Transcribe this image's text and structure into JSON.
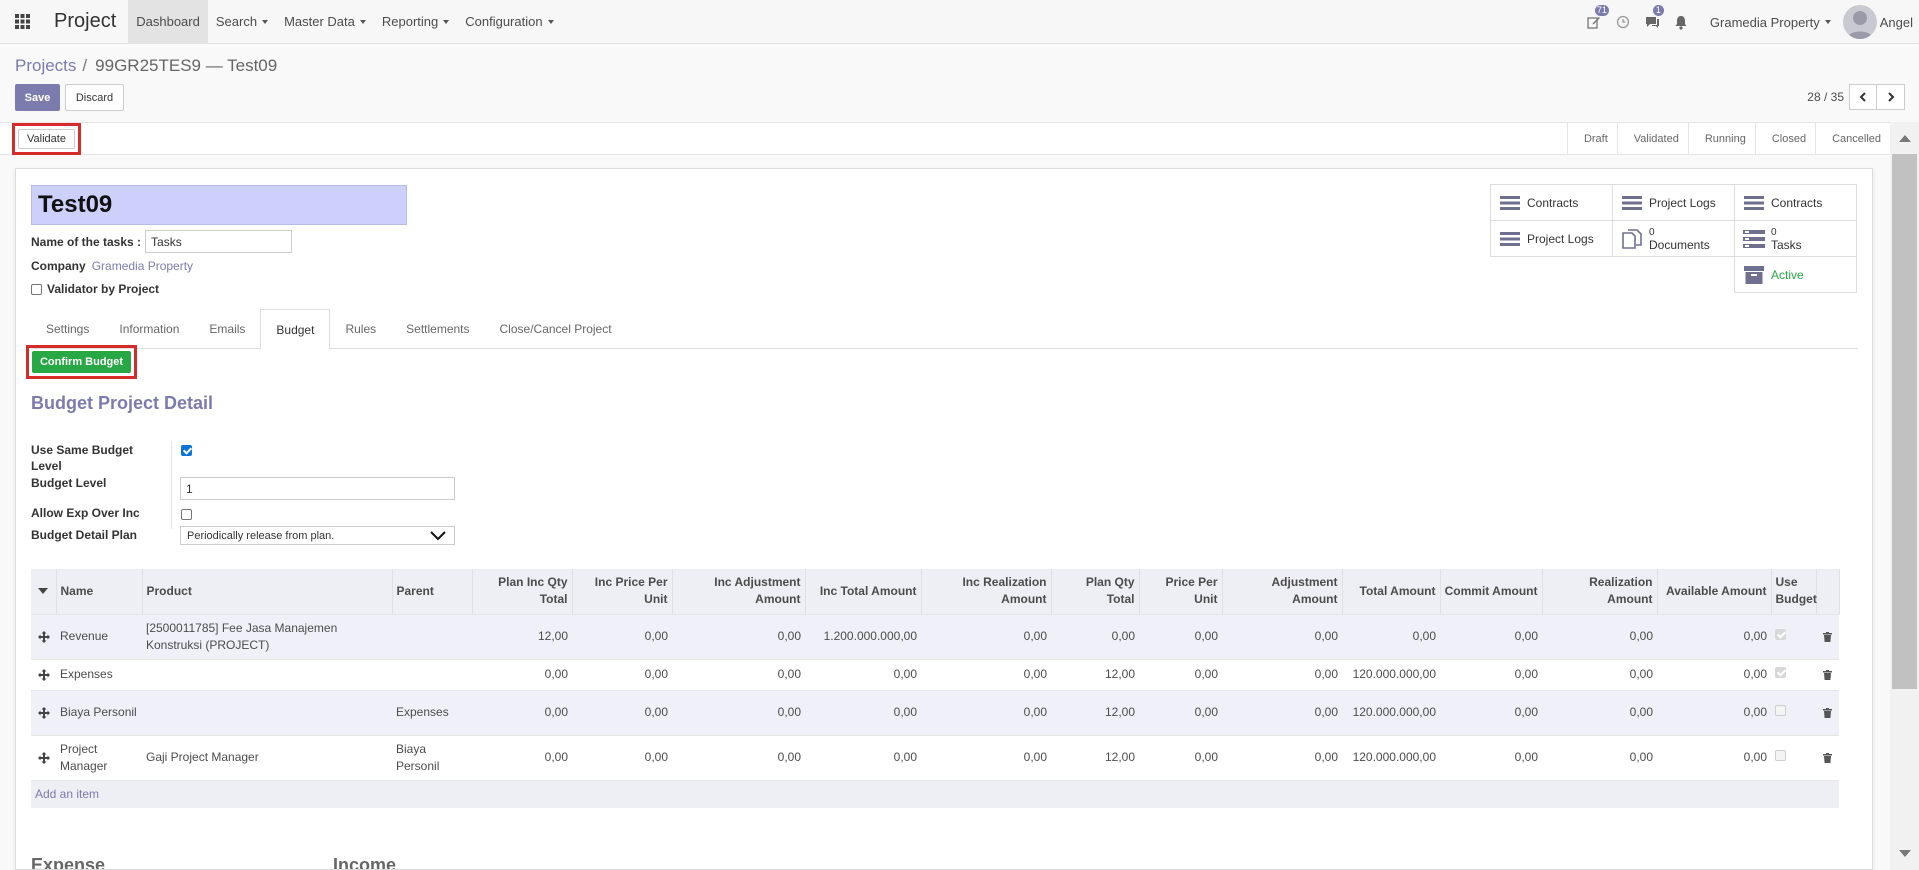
{
  "app": {
    "title": "Project",
    "menu": [
      {
        "label": "Dashboard",
        "active": true,
        "dropdown": false
      },
      {
        "label": "Search",
        "active": false,
        "dropdown": true
      },
      {
        "label": "Master Data",
        "active": false,
        "dropdown": true
      },
      {
        "label": "Reporting",
        "active": false,
        "dropdown": true
      },
      {
        "label": "Configuration",
        "active": false,
        "dropdown": true
      }
    ],
    "systray": {
      "activity_count": "71",
      "messages_count": "1",
      "company": "Gramedia Property",
      "user": "Angel"
    }
  },
  "breadcrumb": {
    "parent": "Projects",
    "separator": "/",
    "current": "99GR25TES9 — Test09"
  },
  "toolbar": {
    "save_label": "Save",
    "discard_label": "Discard"
  },
  "pager": {
    "value": "28 / 35"
  },
  "statusbar": {
    "validate_label": "Validate",
    "stages": [
      "Draft",
      "Validated",
      "Running",
      "Closed",
      "Cancelled"
    ]
  },
  "form": {
    "title": "Test09",
    "tasks_label": "Name of the tasks :",
    "tasks_value": "Tasks",
    "company_label": "Company",
    "company_value": "Gramedia Property",
    "validator_label": "Validator by Project",
    "validator_checked": false
  },
  "smart_buttons": {
    "contracts_1": "Contracts",
    "project_logs_1": "Project Logs",
    "contracts_2": "Contracts",
    "project_logs_2": "Project Logs",
    "documents_count": "0",
    "documents_label": "Documents",
    "tasks_count": "0",
    "tasks_label": "Tasks",
    "active_label": "Active"
  },
  "tabs": [
    "Settings",
    "Information",
    "Emails",
    "Budget",
    "Rules",
    "Settlements",
    "Close/Cancel Project"
  ],
  "budget": {
    "confirm_label": "Confirm Budget",
    "section_title": "Budget Project Detail",
    "same_level_label": "Use Same Budget Level",
    "same_level_checked": true,
    "budget_level_label": "Budget Level",
    "budget_level_value": "1",
    "allow_exp_label": "Allow Exp Over Inc",
    "allow_exp_checked": false,
    "detail_plan_label": "Budget Detail Plan",
    "detail_plan_value": "Periodically release from plan."
  },
  "table": {
    "columns": [
      "Name",
      "Product",
      "Parent",
      "Plan Inc Qty Total",
      "Inc Price Per Unit",
      "Inc Adjustment Amount",
      "Inc Total Amount",
      "Inc Realization Amount",
      "Plan Qty Total",
      "Price Per Unit",
      "Adjustment Amount",
      "Total Amount",
      "Commit Amount",
      "Realization Amount",
      "Available Amount",
      "Use Budget"
    ],
    "rows": [
      {
        "name": "Revenue",
        "product": "[2500011785] Fee Jasa Manajemen Konstruksi (PROJECT)",
        "parent": "",
        "plan_inc_qty": "12,00",
        "inc_price": "0,00",
        "inc_adj": "0,00",
        "inc_total": "1.200.000.000,00",
        "inc_real": "0,00",
        "plan_qty": "0,00",
        "price": "0,00",
        "adj": "0,00",
        "total": "0,00",
        "commit": "0,00",
        "real": "0,00",
        "avail": "0,00",
        "use_budget": true
      },
      {
        "name": "Expenses",
        "product": "",
        "parent": "",
        "plan_inc_qty": "0,00",
        "inc_price": "0,00",
        "inc_adj": "0,00",
        "inc_total": "0,00",
        "inc_real": "0,00",
        "plan_qty": "12,00",
        "price": "0,00",
        "adj": "0,00",
        "total": "120.000.000,00",
        "commit": "0,00",
        "real": "0,00",
        "avail": "0,00",
        "use_budget": true
      },
      {
        "name": "Biaya Personil",
        "product": "",
        "parent": "Expenses",
        "plan_inc_qty": "0,00",
        "inc_price": "0,00",
        "inc_adj": "0,00",
        "inc_total": "0,00",
        "inc_real": "0,00",
        "plan_qty": "12,00",
        "price": "0,00",
        "adj": "0,00",
        "total": "120.000.000,00",
        "commit": "0,00",
        "real": "0,00",
        "avail": "0,00",
        "use_budget": false
      },
      {
        "name": "Project Manager",
        "product": "Gaji Project Manager",
        "parent": "Biaya Personil",
        "plan_inc_qty": "0,00",
        "inc_price": "0,00",
        "inc_adj": "0,00",
        "inc_total": "0,00",
        "inc_real": "0,00",
        "plan_qty": "12,00",
        "price": "0,00",
        "adj": "0,00",
        "total": "120.000.000,00",
        "commit": "0,00",
        "real": "0,00",
        "avail": "0,00",
        "use_budget": false
      }
    ],
    "add_item_label": "Add an item"
  },
  "bottom": {
    "expense_title": "Expense",
    "income_title": "Income"
  },
  "colors": {
    "primary": "#7c7bad",
    "success": "#28a745",
    "highlight": "#d62b2b",
    "title_bg": "#cdd0fb"
  }
}
